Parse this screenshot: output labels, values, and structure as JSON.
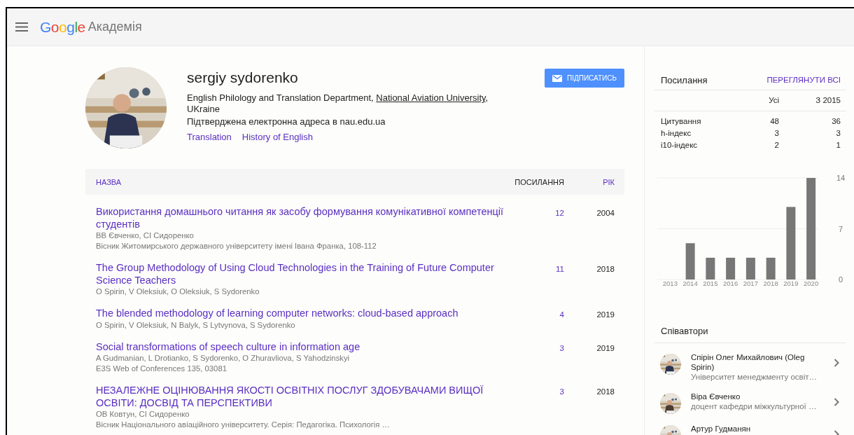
{
  "header": {
    "logo": "Google",
    "product": "Академія"
  },
  "profile": {
    "name": "sergiy sydorenko",
    "affiliation_before": "English Philology and Translation Department, ",
    "affiliation_link": "National Aviation University",
    "affiliation_after": ", UKraine",
    "email_note": "Підтверджена електронна адреса в nau.edu.ua",
    "interests": [
      "Translation",
      "History of English"
    ],
    "follow_button": "ПІДПИСАТИСЬ"
  },
  "table": {
    "columns": [
      {
        "label": "НАЗВА",
        "kind": "title"
      },
      {
        "label": "ПОСИЛАННЯ",
        "kind": "cited"
      },
      {
        "label": "РІК",
        "kind": "year"
      }
    ],
    "rows": [
      {
        "title": "Використання домашнього читання як засобу формування комунікативної компетенції студентів",
        "authors": "ВВ Євченко, СІ Сидоренко",
        "venue": "Вісник Житомирського державного університету імені Івана Франка, 108-112",
        "cited_by": "12",
        "year": "2004"
      },
      {
        "title": "The Group Methodology of Using Cloud Technologies in the Training of Future Computer Science Teachers",
        "authors": "O Spirin, V Oleksiuk, O Oleksiuk, S Sydorenko",
        "cited_by": "11",
        "year": "2018"
      },
      {
        "title": "The blended methodology of learning computer networks: cloud-based approach",
        "authors": "O Spirin, V Oleksiuk, N Balyk, S Lytvynova, S Sydorenko",
        "cited_by": "4",
        "year": "2019"
      },
      {
        "title": "Social transformations of speech culture in information age",
        "authors": "A Gudmanian, L Drotianko, S Sydorenko, O Zhuravliova, S Yahodzinskyi",
        "venue": "E3S Web of Conferences 135, 03081",
        "cited_by": "3",
        "year": "2019"
      },
      {
        "title": "НЕЗАЛЕЖНЕ ОЦІНЮВАННЯ ЯКОСТІ ОСВІТНІХ ПОСЛУГ ЗДОБУВАЧАМИ ВИЩОЇ ОСВІТИ: ДОСВІД ТА ПЕРСПЕКТИВИ",
        "authors": "ОВ Ковтун, СІ Сидоренко",
        "venue": "Вісник Національного авіаційного університету. Серія: Педагогіка. Психологія …",
        "cited_by": "3",
        "year": "2018"
      }
    ]
  },
  "citations": {
    "title": "Посилання",
    "view_all": "ПЕРЕГЛЯНУТИ ВСІ",
    "columns": [
      "Усі",
      "З 2015"
    ],
    "rows": [
      {
        "label": "Цитування",
        "all": "48",
        "since": "36"
      },
      {
        "label": "h-індекс",
        "all": "3",
        "since": "3"
      },
      {
        "label": "i10-індекс",
        "all": "2",
        "since": "1"
      }
    ],
    "chart_data": {
      "type": "bar",
      "categories": [
        "2013",
        "2014",
        "2015",
        "2016",
        "2017",
        "2018",
        "2019",
        "2020"
      ],
      "series": [
        {
          "color": "#777777",
          "values": [
            0,
            5,
            3,
            3,
            3,
            3,
            10,
            14
          ]
        }
      ],
      "ylim": [
        0,
        14
      ],
      "yticks": [
        0,
        7,
        14
      ]
    }
  },
  "coauthors": {
    "title": "Співавтори",
    "items": [
      {
        "name": "Спірін Олег Михайлович (Oleg Spirin)",
        "affiliation": "Університет менеджменту освіт…"
      },
      {
        "name": "Віра Євченко",
        "affiliation": "доцент кафедри міжкультурної …"
      },
      {
        "name": "Артур Гудманян"
      }
    ]
  }
}
